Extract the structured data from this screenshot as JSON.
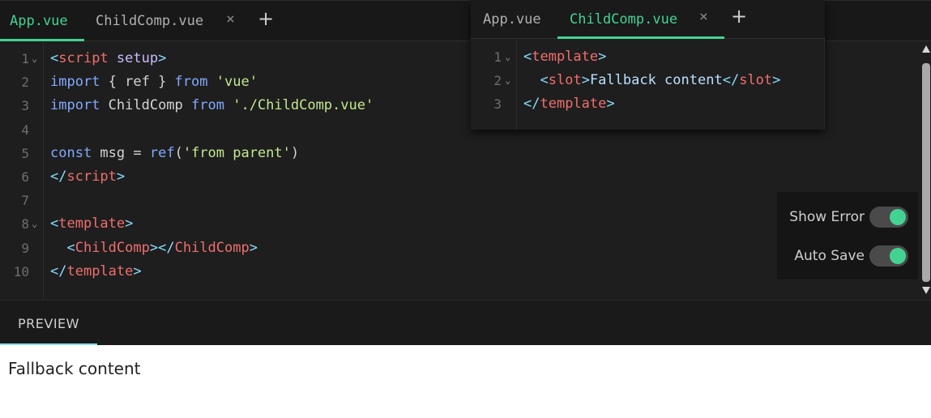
{
  "editor": {
    "tabs": [
      {
        "label": "App.vue",
        "active": true
      },
      {
        "label": "ChildComp.vue",
        "active": false
      }
    ],
    "close_glyph": "×",
    "add_glyph": "+",
    "fold_glyph": "⌄",
    "line_numbers": [
      "1",
      "2",
      "3",
      "4",
      "5",
      "6",
      "7",
      "8",
      "9",
      "10"
    ],
    "lines": {
      "l1": {
        "open": "<",
        "tag": "script",
        "sp": " ",
        "attr": "setup",
        "close": ">"
      },
      "l2": {
        "kw1": "import",
        "mid": " { ref } ",
        "kw2": "from",
        "sp": " ",
        "str": "'vue'"
      },
      "l3": {
        "kw1": "import",
        "mid": " ChildComp ",
        "kw2": "from",
        "sp": " ",
        "str": "'./ChildComp.vue'"
      },
      "l5": {
        "kw": "const",
        "mid": " msg = ",
        "fn": "ref",
        "p1": "(",
        "str": "'from parent'",
        "p2": ")"
      },
      "l6": {
        "open": "</",
        "tag": "script",
        "close": ">"
      },
      "l8": {
        "open": "<",
        "tag": "template",
        "close": ">"
      },
      "l9": {
        "indent": "  ",
        "o1": "<",
        "t1": "ChildComp",
        "c1": "></",
        "t2": "ChildComp",
        "c2": ">"
      },
      "l10": {
        "open": "</",
        "tag": "template",
        "close": ">"
      }
    }
  },
  "popup": {
    "tabs": [
      {
        "label": "App.vue",
        "active": false
      },
      {
        "label": "ChildComp.vue",
        "active": true
      }
    ],
    "close_glyph": "×",
    "add_glyph": "+",
    "fold_glyph": "⌄",
    "line_numbers": [
      "1",
      "2",
      "3"
    ],
    "lines": {
      "l1": {
        "open": "<",
        "tag": "template",
        "close": ">"
      },
      "l2": {
        "indent": "  ",
        "o1": "<",
        "t1": "slot",
        "c1": ">",
        "text": "Fallback content",
        "o2": "</",
        "t2": "slot",
        "c2": ">"
      },
      "l3": {
        "open": "</",
        "tag": "template",
        "close": ">"
      }
    }
  },
  "toggles": [
    {
      "label": "Show Error",
      "on": true
    },
    {
      "label": "Auto Save",
      "on": true
    }
  ],
  "preview": {
    "tab_label": "PREVIEW",
    "output_text": "Fallback content"
  },
  "colors": {
    "accent": "#42d392",
    "preview_accent": "#89ddff",
    "tag": "#ef6f6c",
    "keyword": "#82aaff",
    "string": "#c3e88d"
  }
}
